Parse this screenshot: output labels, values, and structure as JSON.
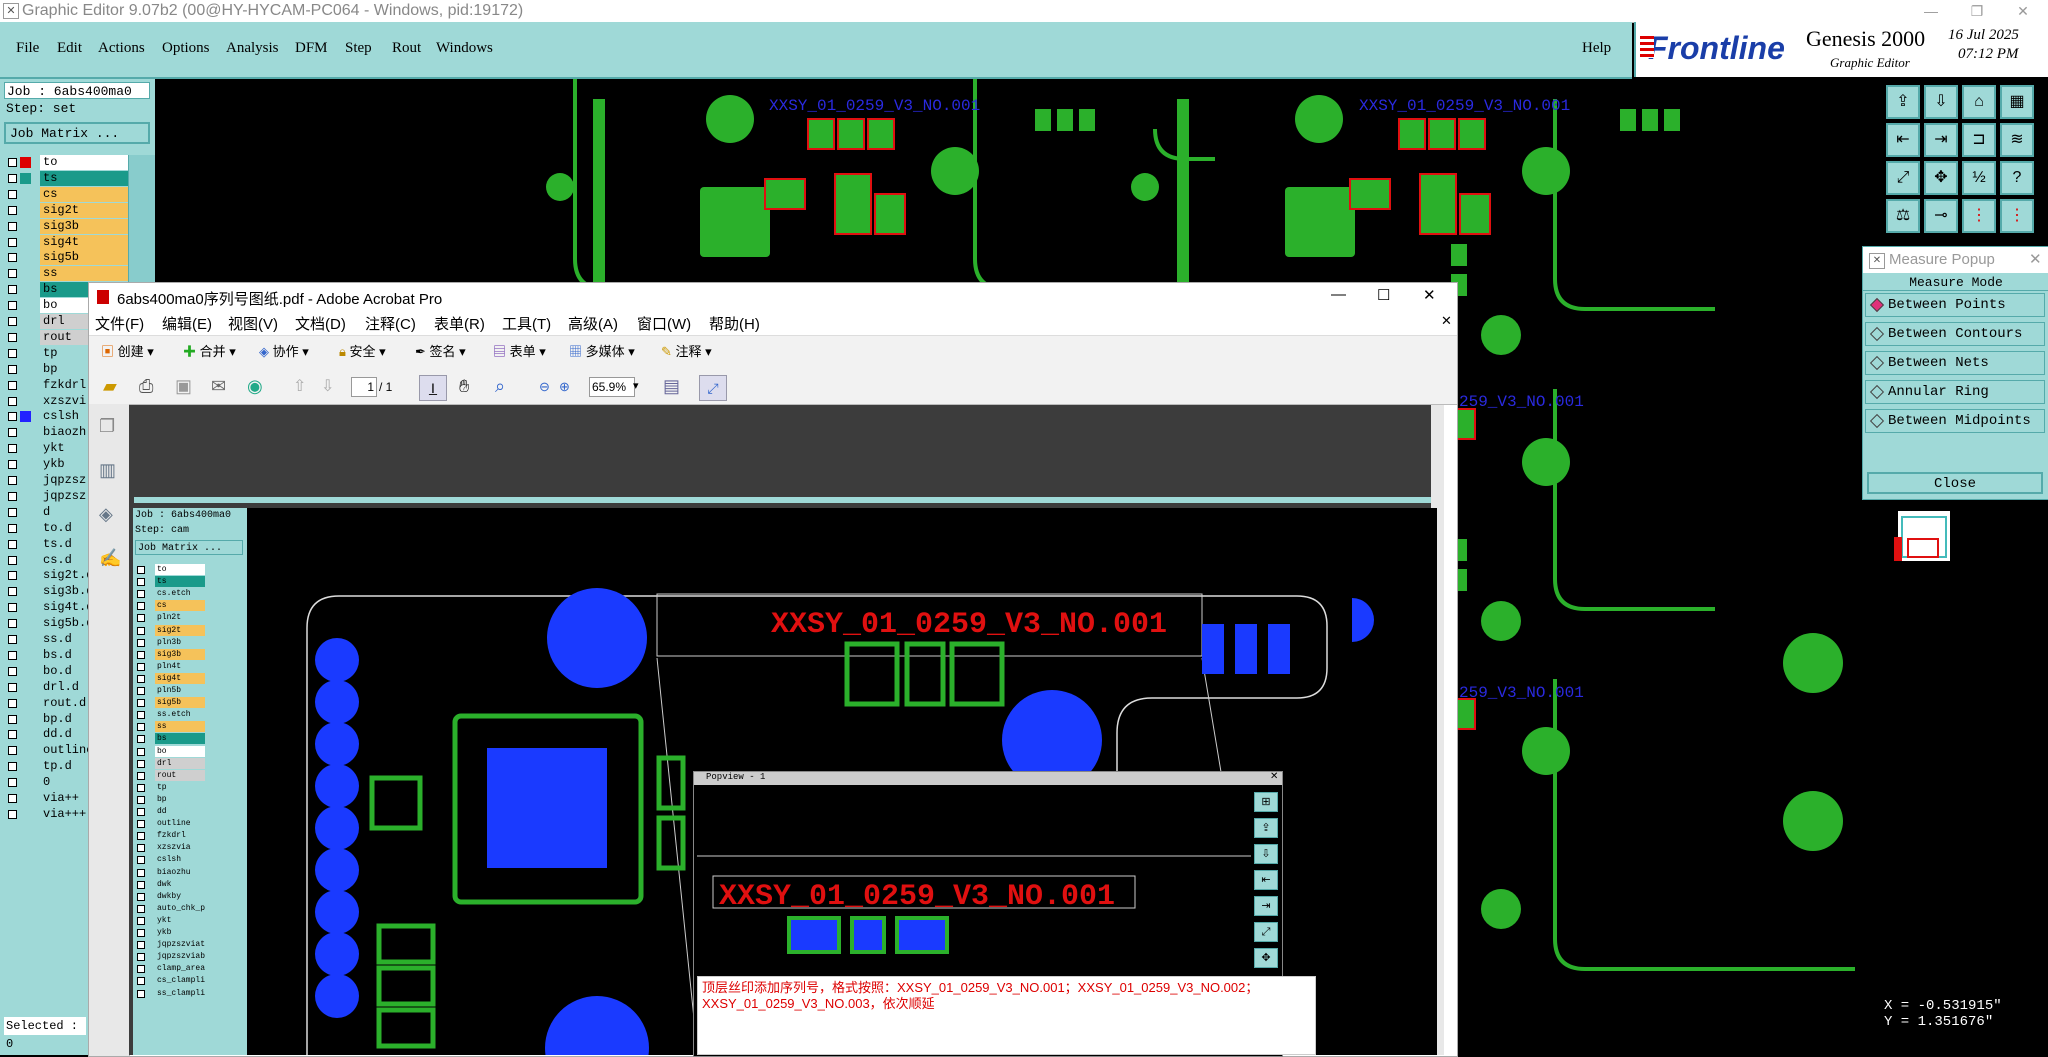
{
  "genesis": {
    "window_title": "Graphic Editor 9.07b2 (00@HY-HYCAM-PC064 - Windows, pid:19172)",
    "menus": [
      "File",
      "Edit",
      "Actions",
      "Options",
      "Analysis",
      "DFM",
      "Step",
      "Rout",
      "Windows"
    ],
    "help": "Help",
    "brand": "Frontline",
    "product": "Genesis 2000",
    "product_sub": "Graphic Editor",
    "date": "16 Jul 2025",
    "time": "07:12 PM",
    "job_label": "Job : 6abs400ma0",
    "step_label": "Step: set",
    "job_matrix": "Job Matrix ...",
    "layers": [
      "to",
      "ts",
      "cs",
      "sig2t",
      "sig3b",
      "sig4t",
      "sig5b",
      "ss",
      "bs",
      "bo",
      "drl",
      "rout",
      "tp",
      "bp",
      "fzkdrl",
      "xzszvi",
      "cslsh",
      "biaozh",
      "ykt",
      "ykb",
      "jqpzsz",
      "jqpzsz",
      "d",
      "to.d",
      "ts.d",
      "cs.d",
      "sig2t.d",
      "sig3b.d",
      "sig4t.d",
      "sig5b.d",
      "ss.d",
      "bs.d",
      "bo.d",
      "drl.d",
      "rout.d",
      "bp.d",
      "dd.d",
      "outline",
      "tp.d",
      "0",
      "via++",
      "via+++"
    ],
    "selected": "Selected : 0",
    "silk_label": "XXSY_01_0259_V3_NO.001",
    "silk_label_cut": "259_V3_NO.001",
    "coords": {
      "x": "X = -0.531915\"",
      "y": "Y = 1.351676\""
    }
  },
  "measure": {
    "title": "Measure Popup",
    "mode_header": "Measure Mode",
    "items": [
      "Between Points",
      "Between Contours",
      "Between Nets",
      "Annular Ring",
      "Between Midpoints"
    ],
    "close": "Close"
  },
  "acrobat": {
    "title": "6abs400ma0序列号图纸.pdf - Adobe Acrobat Pro",
    "menus": [
      "文件(F)",
      "编辑(E)",
      "视图(V)",
      "文档(D)",
      "注释(C)",
      "表单(R)",
      "工具(T)",
      "高级(A)",
      "窗口(W)",
      "帮助(H)"
    ],
    "toolbar": [
      "创建",
      "合并",
      "协作",
      "安全",
      "签名",
      "表单",
      "多媒体",
      "注释"
    ],
    "page_current": "1",
    "page_total": "/ 1",
    "zoom": "65.9%",
    "inner": {
      "job_label": "Job : 6abs400ma0",
      "step_label": "Step: cam",
      "job_matrix": "Job Matrix ...",
      "layers": [
        "to",
        "ts",
        "cs.etch",
        "cs",
        "pln2t",
        "sig2t",
        "pln3b",
        "sig3b",
        "pln4t",
        "sig4t",
        "pln5b",
        "sig5b",
        "ss.etch",
        "ss",
        "bs",
        "bo",
        "drl",
        "rout",
        "tp",
        "bp",
        "dd",
        "outline",
        "fzkdrl",
        "xzszvia",
        "cslsh",
        "biaozhu",
        "dwk",
        "dwkby",
        "auto_chk_pin",
        "ykt",
        "ykb",
        "jqpzszviat",
        "jqpzszviab",
        "clamp_area",
        "cs_clampline",
        "ss_clampline"
      ],
      "silk_label": "XXSY_01_0259_V3_NO.001",
      "popview_title": "Popview - 1",
      "note": "顶层丝印添加序列号，格式按照：XXSY_01_0259_V3_NO.001；XXSY_01_0259_V3_NO.002；XXSY_01_0259_V3_NO.003，依次顺延"
    }
  }
}
